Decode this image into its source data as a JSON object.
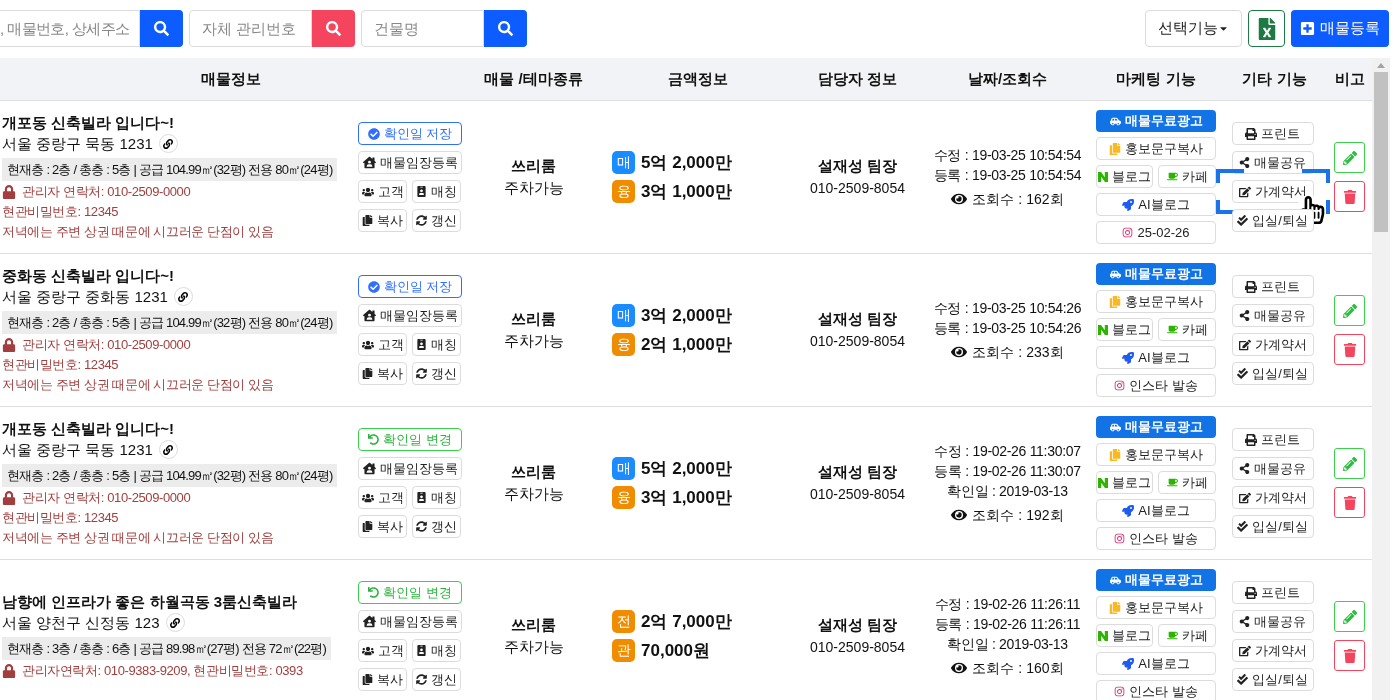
{
  "search": [
    {
      "placeholder": ", 매물번호, 상세주소",
      "kind": "blue"
    },
    {
      "placeholder": "자체 관리번호",
      "kind": "red"
    },
    {
      "placeholder": "건물명",
      "kind": "blue"
    }
  ],
  "toolbar": {
    "select": "선택기능",
    "register": "매물등록"
  },
  "columns": [
    "매물정보",
    "매물 /테마종류",
    "금액정보",
    "담당자 정보",
    "날짜/조회수",
    "마케팅 기능",
    "기타 기능",
    "비고"
  ],
  "rows": [
    {
      "title": "개포동 신축빌라 입니다~!",
      "address": "서울 중랑구 묵동 1231",
      "spec": "현재층 : 2층 / 총층 : 5층  |  공급 104.99㎡(32평) 전용 80㎡(24평)",
      "notes": [
        "관리자 연락처: 010-2509-0000",
        "현관비밀번호: 12345",
        "저녁에는 주변 상권 때문에 시끄러운 단점이 있음"
      ],
      "confirm": {
        "kind": "save",
        "label": "확인일 저장"
      },
      "actions": [
        "매물임장등록",
        "고객",
        "매칭",
        "복사",
        "갱신"
      ],
      "type": {
        "name": "쓰리룸",
        "theme": "주차가능"
      },
      "prices": [
        {
          "badge": "매",
          "amount": "5억 2,000만",
          "color": "#1a8cff"
        },
        {
          "badge": "융",
          "amount": "3억 1,000만",
          "color": "#f08c00"
        }
      ],
      "agent": {
        "name": "설재성 팀장",
        "phone": "010-2509-8054"
      },
      "dates": [
        "수정 : 19-03-25 10:54:54",
        "등록 : 19-03-25 10:54:54"
      ],
      "views": "조회수 : 162회",
      "marketing": {
        "ad": "매물무료광고",
        "copy": "홍보문구복사",
        "blog": "블로그",
        "cafe": "카페",
        "ai": "AI블로그",
        "insta": "25-02-26"
      },
      "etc": [
        {
          "label": "프린트",
          "highlighted": false
        },
        {
          "label": "매물공유",
          "highlighted": false
        },
        {
          "label": "가계약서",
          "highlighted": true
        },
        {
          "label": "입실/퇴실",
          "highlighted": false
        }
      ]
    },
    {
      "title": "중화동 신축빌라 입니다~!",
      "address": "서울 중랑구 중화동 1231",
      "spec": "현재층 : 2층 / 총층 : 5층  |  공급 104.99㎡(32평) 전용 80㎡(24평)",
      "notes": [
        "관리자 연락처: 010-2509-0000",
        "현관비밀번호: 12345",
        "저녁에는 주변 상권 때문에 시끄러운 단점이 있음"
      ],
      "confirm": {
        "kind": "save",
        "label": "확인일 저장"
      },
      "actions": [
        "매물임장등록",
        "고객",
        "매칭",
        "복사",
        "갱신"
      ],
      "type": {
        "name": "쓰리룸",
        "theme": "주차가능"
      },
      "prices": [
        {
          "badge": "매",
          "amount": "3억 2,000만",
          "color": "#1a8cff"
        },
        {
          "badge": "융",
          "amount": "2억 1,000만",
          "color": "#f08c00"
        }
      ],
      "agent": {
        "name": "설재성 팀장",
        "phone": "010-2509-8054"
      },
      "dates": [
        "수정 : 19-03-25 10:54:26",
        "등록 : 19-03-25 10:54:26"
      ],
      "views": "조회수 : 233회",
      "marketing": {
        "ad": "매물무료광고",
        "copy": "홍보문구복사",
        "blog": "블로그",
        "cafe": "카페",
        "ai": "AI블로그",
        "insta": "인스타 발송"
      },
      "etc": [
        {
          "label": "프린트",
          "highlighted": false
        },
        {
          "label": "매물공유",
          "highlighted": false
        },
        {
          "label": "가계약서",
          "highlighted": false
        },
        {
          "label": "입실/퇴실",
          "highlighted": false
        }
      ]
    },
    {
      "title": "개포동 신축빌라 입니다~!",
      "address": "서울 중랑구 묵동 1231",
      "spec": "현재층 : 2층 / 총층 : 5층  |  공급 104.99㎡(32평) 전용 80㎡(24평)",
      "notes": [
        "관리자 연락처: 010-2509-0000",
        "현관비밀번호: 12345",
        "저녁에는 주변 상권 때문에 시끄러운 단점이 있음"
      ],
      "confirm": {
        "kind": "change",
        "label": "확인일 변경"
      },
      "actions": [
        "매물임장등록",
        "고객",
        "매칭",
        "복사",
        "갱신"
      ],
      "type": {
        "name": "쓰리룸",
        "theme": "주차가능"
      },
      "prices": [
        {
          "badge": "매",
          "amount": "5억 2,000만",
          "color": "#1a8cff"
        },
        {
          "badge": "융",
          "amount": "3억 1,000만",
          "color": "#f08c00"
        }
      ],
      "agent": {
        "name": "설재성 팀장",
        "phone": "010-2509-8054"
      },
      "dates": [
        "수정 : 19-02-26 11:30:07",
        "등록 : 19-02-26 11:30:07",
        "확인일 : 2019-03-13"
      ],
      "views": "조회수 : 192회",
      "marketing": {
        "ad": "매물무료광고",
        "copy": "홍보문구복사",
        "blog": "블로그",
        "cafe": "카페",
        "ai": "AI블로그",
        "insta": "인스타 발송"
      },
      "etc": [
        {
          "label": "프린트",
          "highlighted": false
        },
        {
          "label": "매물공유",
          "highlighted": false
        },
        {
          "label": "가계약서",
          "highlighted": false
        },
        {
          "label": "입실/퇴실",
          "highlighted": false
        }
      ]
    },
    {
      "title": "남향에 인프라가 좋은 하월곡동 3룸신축빌라",
      "address": "서울 양천구 신정동 123",
      "spec": "현재층 : 3층 / 총층 : 6층  |  공급 89.98㎡(27평) 전용 72㎡(22평)",
      "notes": [
        "관리자연락처: 010-9383-9209, 현관비밀번호: 0393"
      ],
      "confirm": {
        "kind": "change",
        "label": "확인일 변경"
      },
      "actions": [
        "매물임장등록",
        "고객",
        "매칭",
        "복사",
        "갱신"
      ],
      "type": {
        "name": "쓰리룸",
        "theme": "주차가능"
      },
      "prices": [
        {
          "badge": "전",
          "amount": "2억 7,000만",
          "color": "#f08c00"
        },
        {
          "badge": "관",
          "amount": "70,000원",
          "color": "#f08c00"
        }
      ],
      "agent": {
        "name": "설재성 팀장",
        "phone": "010-2509-8054"
      },
      "dates": [
        "수정 : 19-02-26 11:26:11",
        "등록 : 19-02-26 11:26:11",
        "확인일 : 2019-03-13"
      ],
      "views": "조회수 : 160회",
      "marketing": {
        "ad": "매물무료광고",
        "copy": "홍보문구복사",
        "blog": "블로그",
        "cafe": "카페",
        "ai": "AI블로그",
        "insta": "인스타 발송"
      },
      "etc": [
        {
          "label": "프린트",
          "highlighted": false
        },
        {
          "label": "매물공유",
          "highlighted": false
        },
        {
          "label": "가계약서",
          "highlighted": false
        },
        {
          "label": "입실/퇴실",
          "highlighted": false
        }
      ]
    }
  ]
}
